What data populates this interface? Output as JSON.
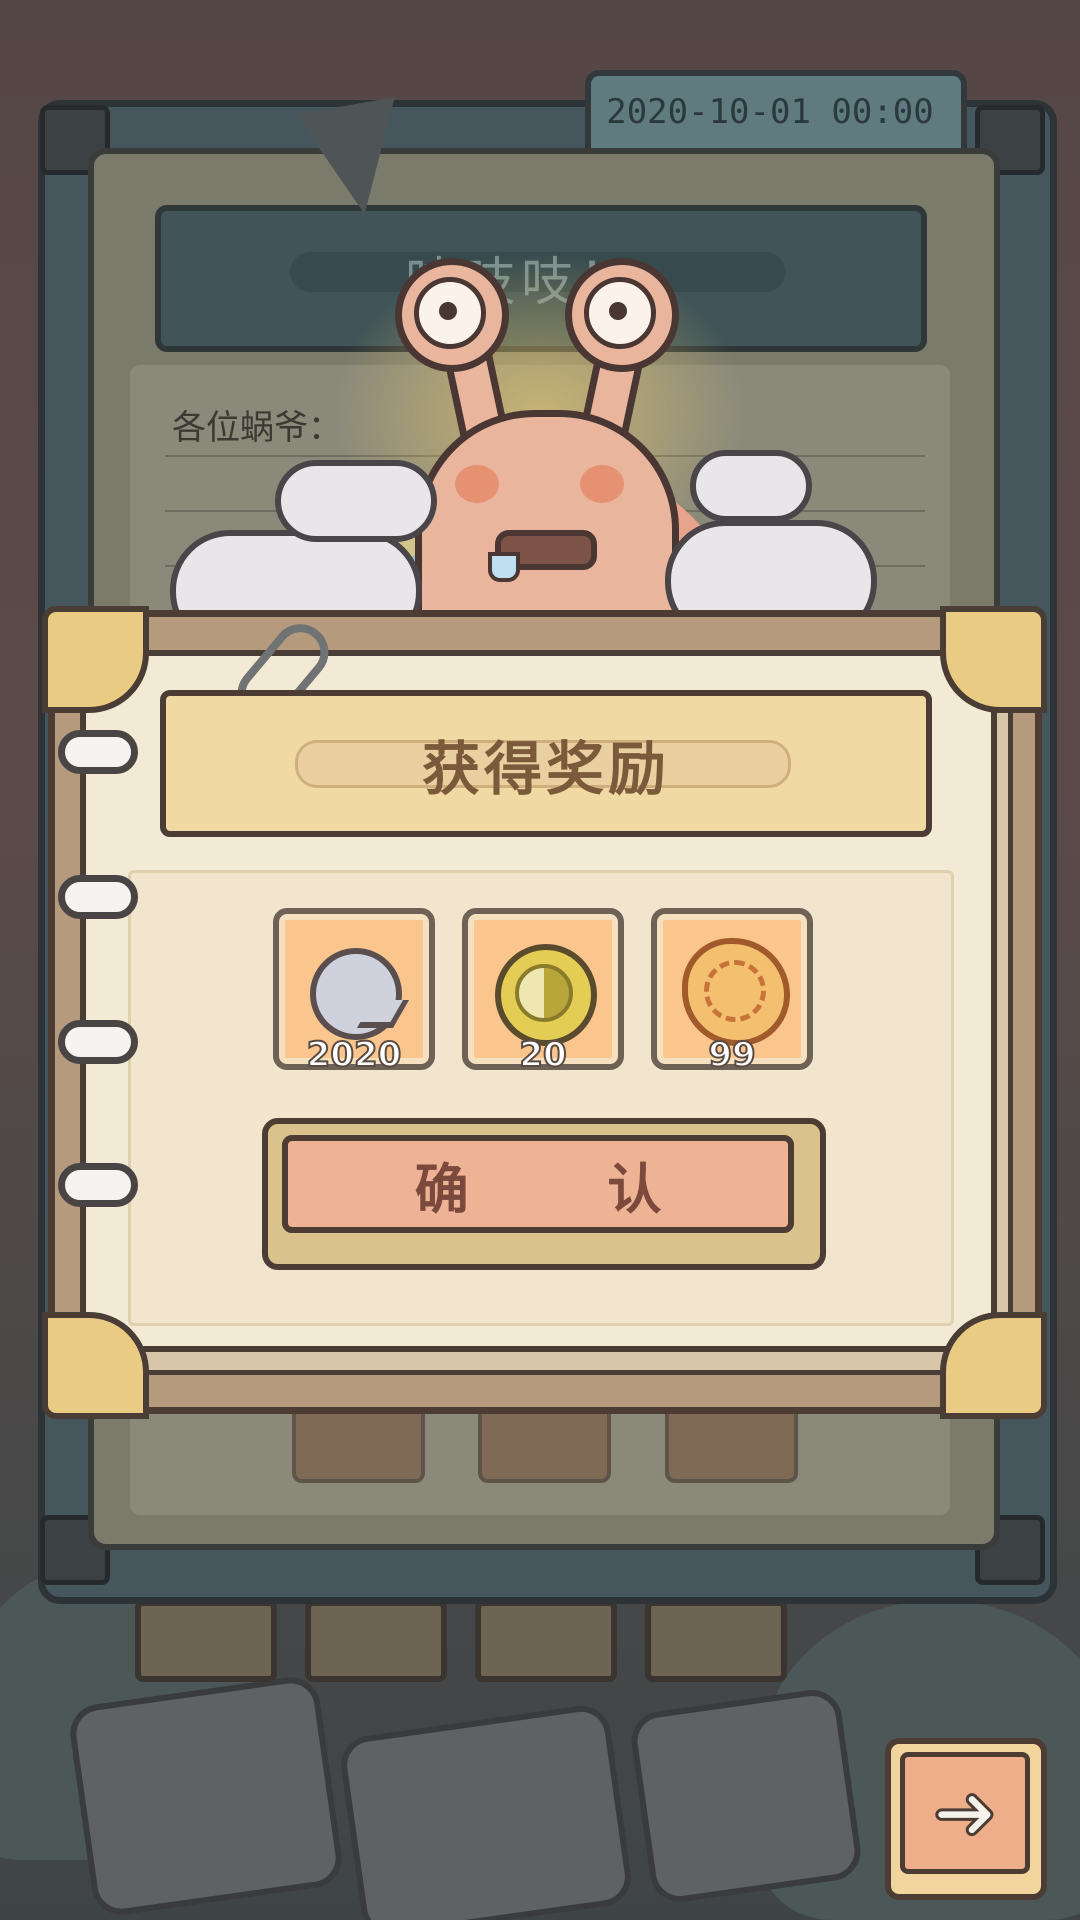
{
  "mail": {
    "date": "2020-10-01 00:00",
    "title": "吱吱吱！",
    "greeting": "各位蜗爷："
  },
  "reward_popup": {
    "title": "获得奖励",
    "items": [
      {
        "icon": "speech-bubble-icon",
        "count": "2020"
      },
      {
        "icon": "yin-yang-coin-icon",
        "count": "20"
      },
      {
        "icon": "mooncake-icon",
        "count": "99"
      }
    ],
    "confirm_label": "确 认"
  },
  "nav": {
    "next_icon": "➜"
  },
  "colors": {
    "popup_paper": "#f3ead6",
    "item_bg": "#fbc58e",
    "confirm_button": "#eeb294",
    "title_bar": "#f1d9a3"
  }
}
